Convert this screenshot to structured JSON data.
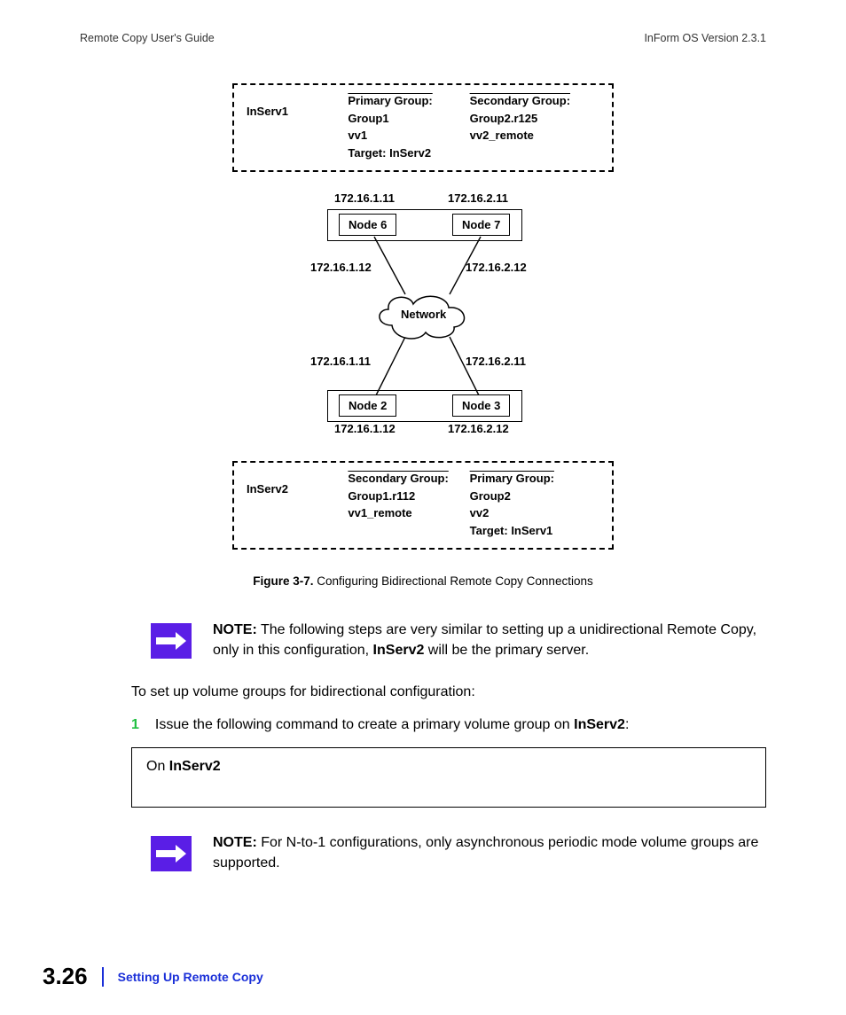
{
  "header": {
    "left": "Remote Copy User's Guide",
    "right": "InForm OS Version 2.3.1"
  },
  "diagram": {
    "top_box": {
      "label": "InServ1",
      "col1_title": "Primary Group:",
      "col1_l1": "Group1",
      "col1_l2": "vv1",
      "col1_l3": "Target: InServ2",
      "col2_title": "Secondary Group:",
      "col2_l1": "Group2.r125",
      "col2_l2": "vv2_remote"
    },
    "top_pair": {
      "left_ip_top": "172.16.1.11",
      "left_node": "Node 6",
      "right_ip_top": "172.16.2.11",
      "right_node": "Node 7",
      "left_ip_bot": "172.16.1.12",
      "right_ip_bot": "172.16.2.12"
    },
    "network": "Network",
    "bot_pair": {
      "left_ip_top": "172.16.1.11",
      "right_ip_top": "172.16.2.11",
      "left_node": "Node 2",
      "right_node": "Node 3",
      "left_ip_bot": "172.16.1.12",
      "right_ip_bot": "172.16.2.12"
    },
    "bot_box": {
      "label": "InServ2",
      "col1_title": "Secondary Group:",
      "col1_l1": "Group1.r112",
      "col1_l2": "vv1_remote",
      "col2_title": "Primary Group:",
      "col2_l1": "Group2",
      "col2_l2": "vv2",
      "col2_l3": "Target: InServ1"
    }
  },
  "figure": {
    "label": "Figure 3-7.",
    "caption": "Configuring Bidirectional Remote Copy Connections"
  },
  "note1": {
    "bold": "NOTE:",
    "t1": " The following steps are very similar to setting up a unidirectional Remote Copy, only in this configuration, ",
    "b1": "InServ2",
    "t2": " will be the primary server."
  },
  "body1": "To set up volume groups for bidirectional configuration:",
  "step1": {
    "num": "1",
    "t1": "Issue the following command to create a primary volume group on ",
    "b1": "InServ2",
    "t2": ":"
  },
  "cmdbox": {
    "t1": "On ",
    "b1": "InServ2"
  },
  "note2": {
    "bold": "NOTE:",
    "t1": " For N-to-1 configurations, only asynchronous periodic mode volume groups are supported."
  },
  "footer": {
    "pagenum": "3.26",
    "section": "Setting Up Remote Copy"
  }
}
